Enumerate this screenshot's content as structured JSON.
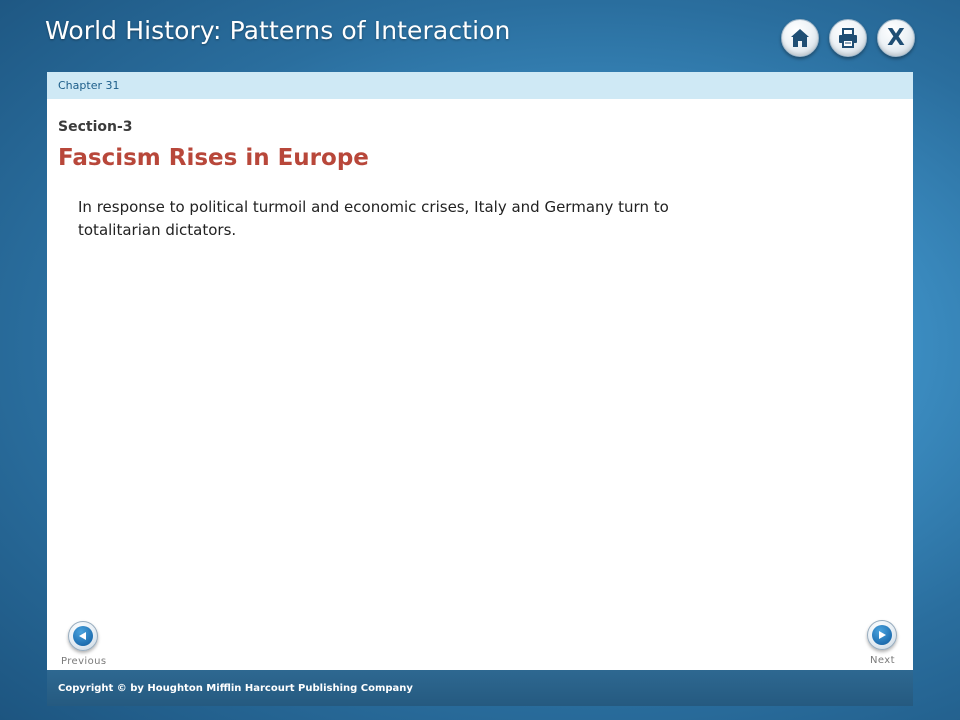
{
  "header": {
    "app_title": "World History: Patterns of Interaction",
    "toolbar": [
      {
        "icon": "home-icon"
      },
      {
        "icon": "print-icon"
      },
      {
        "icon": "close-icon",
        "glyph": "X"
      }
    ]
  },
  "content": {
    "chapter_label": "Chapter 31",
    "section_label": "Section-3",
    "section_title": "Fascism Rises in Europe",
    "body_text": "In response to political turmoil and economic crises, Italy and Germany turn to totalitarian dictators."
  },
  "navigation": {
    "previous_label": "Previous",
    "next_label": "Next"
  },
  "footer": {
    "copyright": "Copyright © by Houghton Mifflin Harcourt Publishing Company"
  },
  "colors": {
    "background": "#3d8fc4",
    "chapter_bar": "#cfe9f5",
    "section_title": "#b8473a",
    "footer_bar": "#2e6891",
    "nav_button": "#1f6fb1"
  }
}
